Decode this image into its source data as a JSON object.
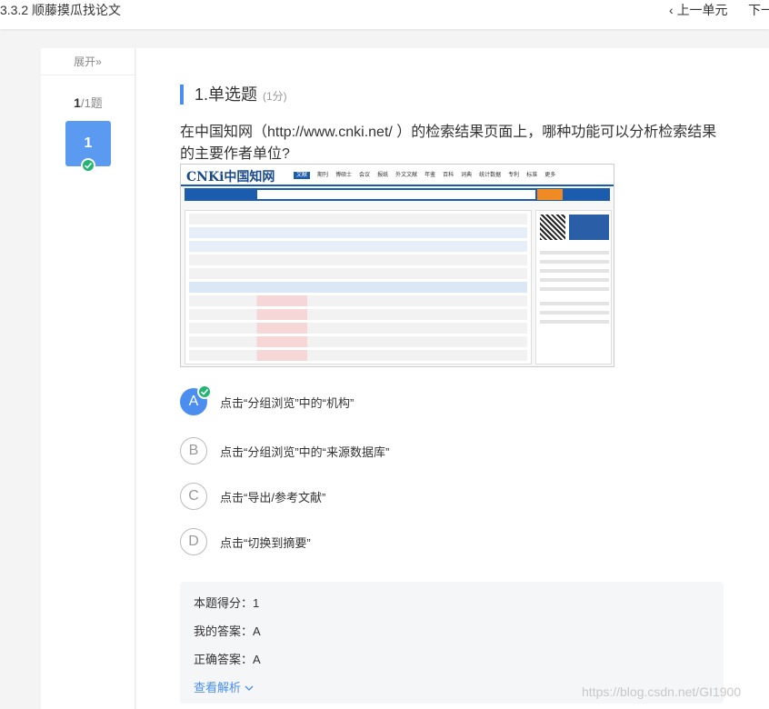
{
  "header": {
    "title": "3.3.2 顺藤摸瓜找论文",
    "prev_label": "上一单元",
    "next_label": "下一"
  },
  "sidebar": {
    "expand_label": "展开»",
    "current": "1",
    "total_label": "/1题",
    "question_number": "1"
  },
  "question": {
    "heading": "1.单选题",
    "score": "(1分)",
    "stem": "在中国知网（http://www.cnki.net/ ）的检索结果页面上，哪种功能可以分析检索结果的主要作者单位?",
    "options": [
      {
        "letter": "A",
        "text": "点击“分组浏览”中的“机构”",
        "selected": true
      },
      {
        "letter": "B",
        "text": "点击“分组浏览”中的“来源数据库”",
        "selected": false
      },
      {
        "letter": "C",
        "text": "点击“导出/参考文献”",
        "selected": false
      },
      {
        "letter": "D",
        "text": "点击“切换到摘要”",
        "selected": false
      }
    ]
  },
  "result": {
    "score_line": "本题得分：1",
    "my_answer": "我的答案：A",
    "correct_answer": "正确答案：A",
    "analysis_link": "查看解析"
  },
  "screenshot": {
    "logo": "CNKi中国知网",
    "nav": [
      "文献",
      "期刊",
      "博硕士",
      "会议",
      "报纸",
      "外文文献",
      "年鉴",
      "百科",
      "词典",
      "统计数据",
      "专利",
      "标准",
      "更多"
    ]
  },
  "watermark": "https://blog.csdn.net/GI1900",
  "colors": {
    "accent": "#4b8ef0",
    "correct": "#22b573",
    "cnki_blue": "#1c5cae"
  }
}
